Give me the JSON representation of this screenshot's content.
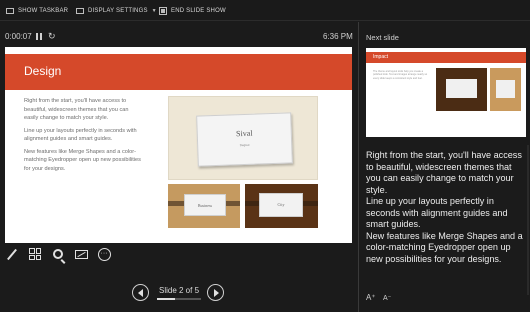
{
  "toolbar": {
    "show_taskbar": "SHOW TASKBAR",
    "display_settings": "DISPLAY SETTINGS",
    "end_slide_show": "END SLIDE SHOW"
  },
  "timer": {
    "elapsed": "0:00:07",
    "clock": "6:36 PM"
  },
  "current_slide": {
    "title": "Design",
    "paragraphs": [
      "Right from the start, you'll have access to beautiful, widescreen themes that you can easily change to match your style.",
      "Line up your layouts perfectly in seconds with alignment guides and smart guides.",
      "New features like Merge Shapes and a color-matching Eyedropper open up new possibilities for your designs."
    ],
    "card_big": {
      "name": "Sival",
      "sub": "Degree"
    },
    "card_small1": "Business",
    "card_small2": "City"
  },
  "tools": [
    "pen-icon",
    "slides-grid-icon",
    "zoom-icon",
    "screen-icon",
    "more-options-icon"
  ],
  "navigation": {
    "counter": "Slide 2 of 5",
    "progress": 0.4
  },
  "next_slide": {
    "label": "Next slide",
    "title": "Impact",
    "text": "The theme and layout tools help you create a polished look. Text and images arrange neatly so every slide keeps a consistent style and feel."
  },
  "notes": "Right from the start, you'll have access to beautiful, widescreen themes that you can easily change to match your style.\nLine up your layouts perfectly in seconds with alignment guides and smart guides.\nNew features like Merge Shapes and a color-matching Eyedropper open up new possibilities for your designs.",
  "font_controls": {
    "increase": "A⁺",
    "decrease": "A⁻"
  },
  "colors": {
    "accent": "#d5492a",
    "background": "#1b1b1b"
  }
}
